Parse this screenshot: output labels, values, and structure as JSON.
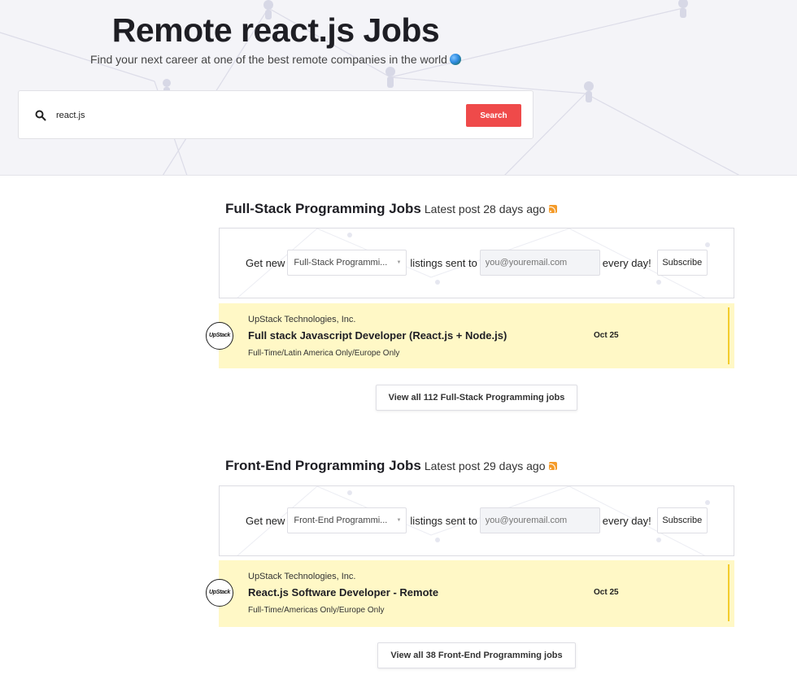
{
  "hero": {
    "title": "Remote react.js Jobs",
    "subtitle": "Find your next career at one of the best remote companies in the world",
    "globe_icon": "globe-icon"
  },
  "search": {
    "value": "react.js",
    "button_label": "Search",
    "icon": "search-icon"
  },
  "colors": {
    "accent_red": "#ef4a4a",
    "card_yellow": "#fff8c6",
    "card_bar": "#f3cc2c",
    "rss_orange": "#f49b2a"
  },
  "sections": [
    {
      "title": "Full-Stack Programming Jobs",
      "latest": "Latest post 28 days ago",
      "subscribe": {
        "prefix": "Get new",
        "selected_category": "Full-Stack Programmi...",
        "middle": "listings sent to",
        "email_placeholder": "you@youremail.com",
        "suffix": "every day!",
        "button_label": "Subscribe"
      },
      "job": {
        "company": "UpStack Technologies, Inc.",
        "logo_text": "UpStack",
        "title": "Full stack Javascript Developer (React.js + Node.js)",
        "tags": "Full-Time/Latin America Only/Europe Only",
        "date": "Oct 25"
      },
      "view_all_label": "View all 112 Full-Stack Programming jobs"
    },
    {
      "title": "Front-End Programming Jobs",
      "latest": "Latest post 29 days ago",
      "subscribe": {
        "prefix": "Get new",
        "selected_category": "Front-End Programmi...",
        "middle": "listings sent to",
        "email_placeholder": "you@youremail.com",
        "suffix": "every day!",
        "button_label": "Subscribe"
      },
      "job": {
        "company": "UpStack Technologies, Inc.",
        "logo_text": "UpStack",
        "title": "React.js Software Developer - Remote",
        "tags": "Full-Time/Americas Only/Europe Only",
        "date": "Oct 25"
      },
      "view_all_label": "View all 38 Front-End Programming jobs"
    }
  ]
}
